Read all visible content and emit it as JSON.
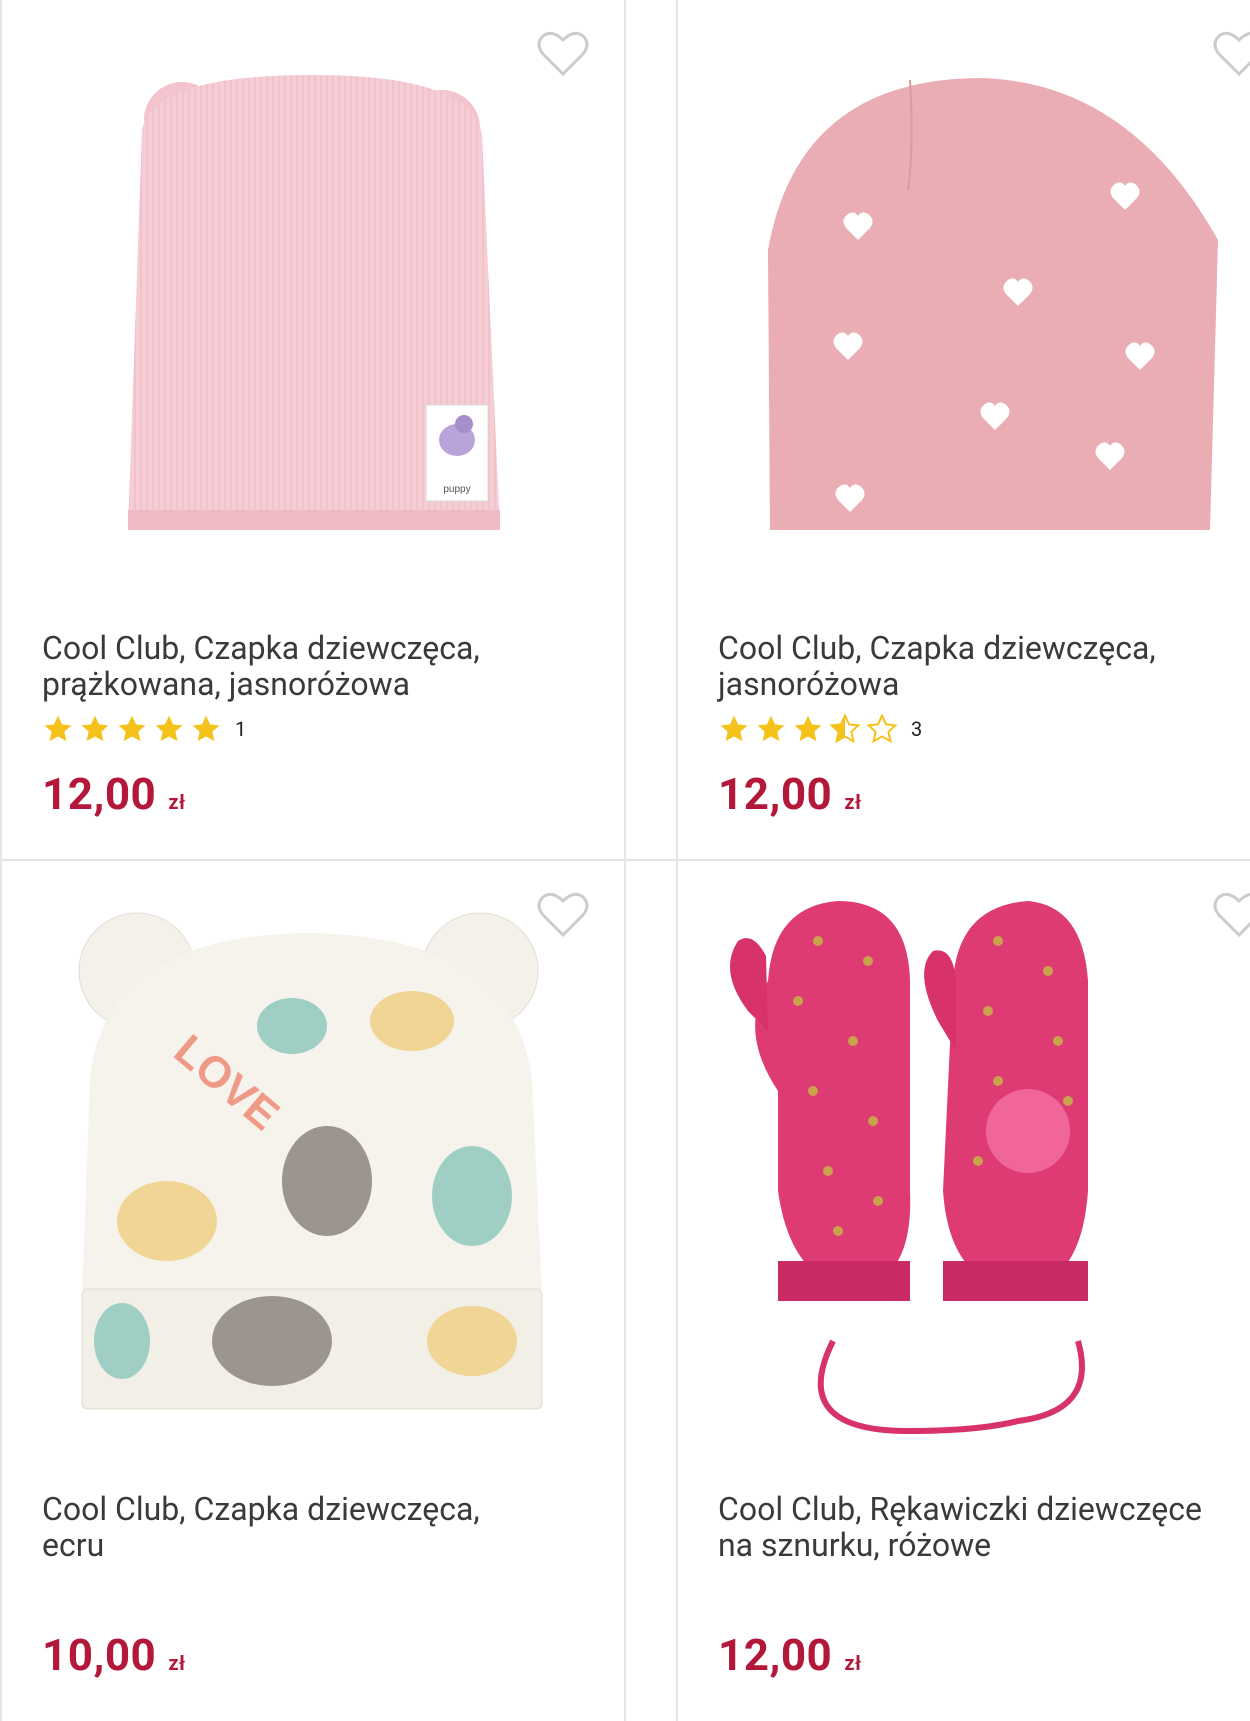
{
  "products": [
    {
      "title_line1": "Cool Club, Czapka dziewczęca,",
      "title_line2": "prążkowana, jasnoróżowa",
      "rating": 5,
      "reviews": "1",
      "price": "12,00",
      "currency": "zł"
    },
    {
      "title_line1": "Cool Club, Czapka dziewczęca,",
      "title_line2": "jasnoróżowa",
      "rating": 3.5,
      "reviews": "3",
      "price": "12,00",
      "currency": "zł"
    },
    {
      "title_line1": "Cool Club, Czapka dziewczęca,",
      "title_line2": "ecru",
      "price": "10,00",
      "currency": "zł"
    },
    {
      "title_line1": "Cool Club, Rękawiczki dziewczęce",
      "title_line2": "na sznurku, różowe",
      "price": "12,00",
      "currency": "zł"
    }
  ],
  "colors": {
    "price": "#b3183a",
    "star": "#f5c21b",
    "heart_outline": "#cccccc"
  },
  "icons": [
    "heart-outline-icon",
    "star-filled-icon",
    "star-half-icon",
    "star-empty-icon"
  ]
}
